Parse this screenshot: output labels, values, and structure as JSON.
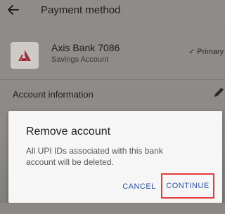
{
  "header": {
    "title": "Payment method",
    "back_icon": "arrow-left-icon"
  },
  "account": {
    "bank_name": "Axis Bank 7086",
    "account_type": "Savings Account",
    "primary_label": "✓ Primary",
    "logo_icon": "axis-bank-logo-icon",
    "logo_color": "#9b2b3a"
  },
  "section": {
    "title": "Account information",
    "edit_icon": "pencil-icon"
  },
  "dialog": {
    "title": "Remove account",
    "message": "All UPI IDs associated with this bank account will be deleted.",
    "cancel_label": "CANCEL",
    "continue_label": "CONTINUE",
    "button_color": "#2f51a6",
    "highlight_color": "#e43c3c"
  }
}
